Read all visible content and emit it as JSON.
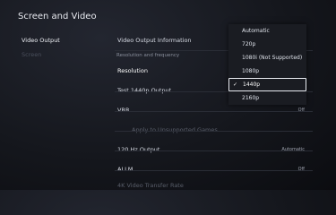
{
  "header": {
    "title": "Screen and Video"
  },
  "sidebar": {
    "items": [
      {
        "label": "Video Output"
      },
      {
        "label": "Screen"
      }
    ]
  },
  "main": {
    "video_output_information": "Video Output Information",
    "section_label": "Resolution and frequency",
    "resolution": {
      "label": "Resolution"
    },
    "test_1440p": {
      "label": "Test 1440p Output"
    },
    "vrr": {
      "label": "VRR",
      "value": "Off"
    },
    "vrr_unsupported": {
      "label": "Apply to Unsupported Games"
    },
    "hz120": {
      "label": "120 Hz Output",
      "value": "Automatic"
    },
    "allm": {
      "label": "ALLM",
      "value": "Off"
    },
    "bottom_partial": {
      "label": "4K Video Transfer Rate"
    }
  },
  "dropdown": {
    "options": [
      {
        "label": "Automatic"
      },
      {
        "label": "720p"
      },
      {
        "label": "1080i (Not Supported)"
      },
      {
        "label": "1080p"
      },
      {
        "label": "1440p",
        "selected": true
      },
      {
        "label": "2160p"
      }
    ],
    "check_glyph": "✓"
  }
}
